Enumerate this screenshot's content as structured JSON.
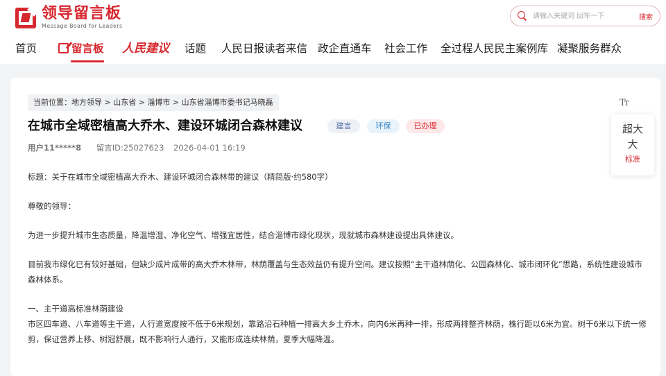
{
  "brand": {
    "name_cn": "领导留言板",
    "name_en": "Message Board for Leaders"
  },
  "search": {
    "placeholder": "请输入关键词 回车一下",
    "button_label": "搜索"
  },
  "nav": {
    "items": [
      {
        "label": "首页"
      },
      {
        "label": "留言板"
      },
      {
        "label": "人民建议"
      },
      {
        "label": "话题"
      },
      {
        "label": "人民日报读者来信"
      },
      {
        "label": "政企直通车"
      },
      {
        "label": "社会工作"
      },
      {
        "label": "全过程人民民主案例库"
      },
      {
        "label": "凝聚服务群众"
      }
    ]
  },
  "breadcrumb": "当前位置：地方领导 > 山东省 > 淄博市 > 山东省淄博市委书记马晓磊",
  "post": {
    "title": "在城市全域密植高大乔木、建设环城闭合森林建议",
    "tags": [
      "建言",
      "环保",
      "已办理"
    ],
    "user": "用户11*****8",
    "message_id": "留言ID:25027623",
    "datetime": "2026-04-01 16:19",
    "paragraphs": [
      "标题：关于在城市全域密植高大乔木、建设环城闭合森林带的建议（精简版·约580字）",
      "尊敬的领导：",
      "为进一步提升城市生态质量，降温增湿、净化空气、增强宜居性，结合淄博市绿化现状，现就城市森林建设提出具体建议。",
      "目前我市绿化已有较好基础，但缺少成片成带的高大乔木林带，林荫覆盖与生态效益仍有提升空间。建议按照“主干道林荫化、公园森林化、城市闭环化”思路，系统性建设城市森林体系。",
      "一、主干道高标准林荫建设",
      "市区四车道、八车道等主干道，人行道宽度按不低于6米规划，靠路沿石种植一排高大乡土乔木，向内6米再种一排，形成两排整齐林荫，株行距以6米为宜。树干6米以下统一修剪，保证营养上移、树冠舒展，既不影响行人通行，又能形成连续林荫，夏季大幅降温。"
    ]
  },
  "font_panel": {
    "large": "超大",
    "medium": "大",
    "standard": "标准",
    "icon_label": "Tт"
  }
}
